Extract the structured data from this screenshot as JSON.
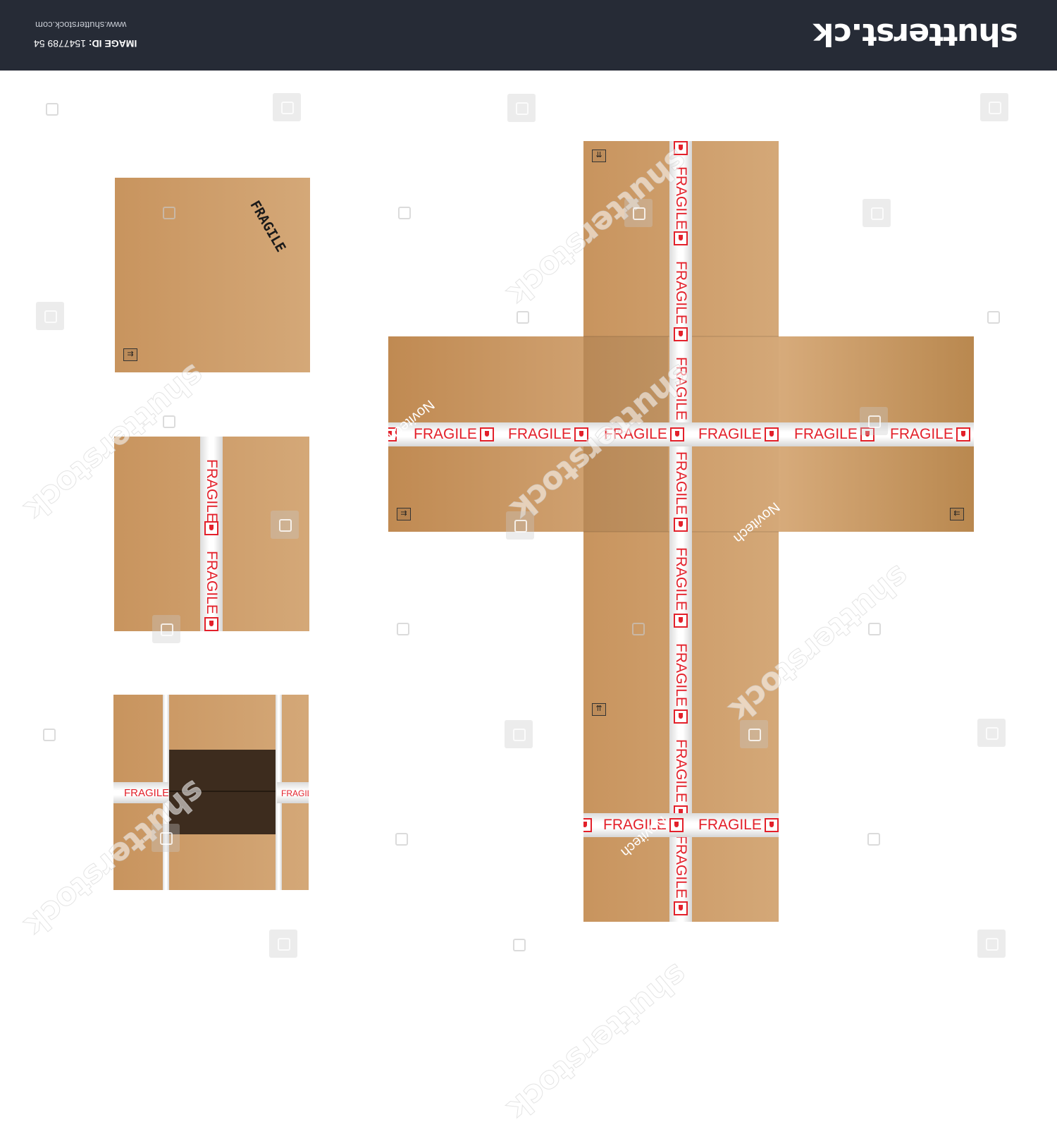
{
  "header": {
    "brand": "shutterst.ck",
    "site_url": "www.shutterstock.com",
    "image_id_label": "IMAGE ID:",
    "image_id_value": "1547789 54"
  },
  "panels": {
    "stamp_text": "FRAGILE",
    "tape_word": "FRAGILE",
    "credit": "Novitech"
  },
  "watermark": {
    "word": "shutterstock",
    "icon": "shutterstock-logo-icon"
  },
  "colors": {
    "banner": "#262b36",
    "cardboard": "#c99a66",
    "tape_text": "#e3202a",
    "box_interior": "#3d2c1e"
  }
}
